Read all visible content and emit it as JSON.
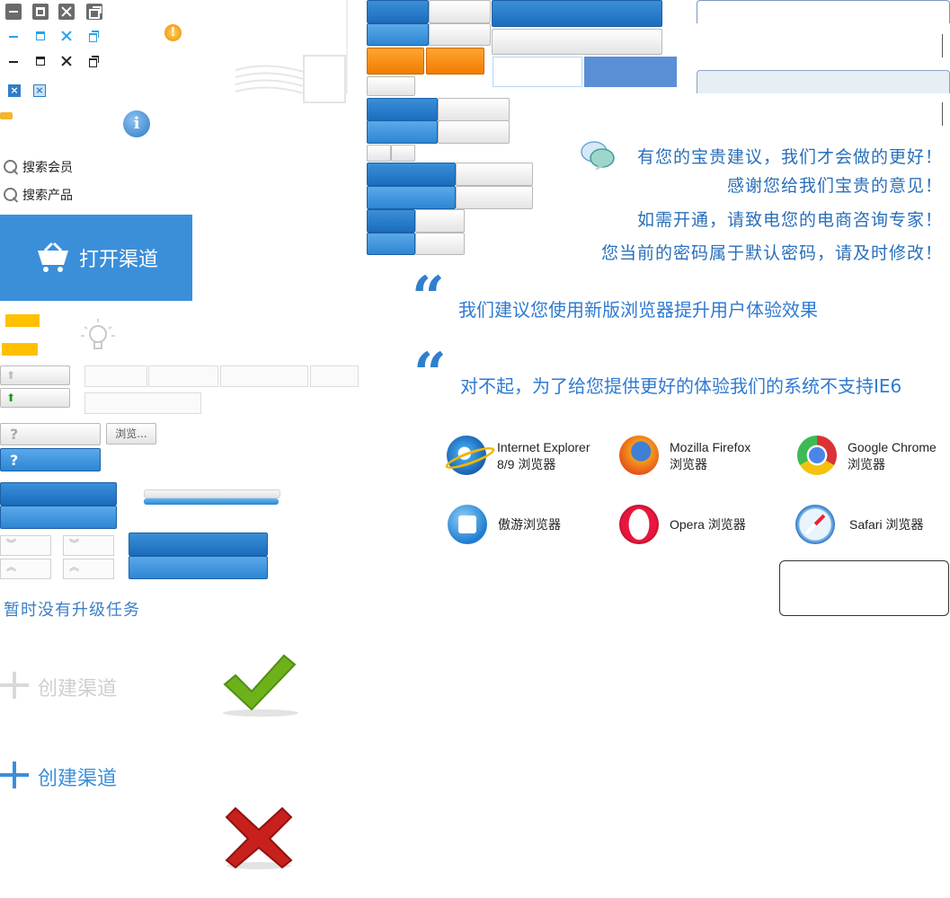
{
  "search": {
    "members": "搜索会员",
    "products": "搜索产品"
  },
  "open_channel": {
    "label": "打开渠道"
  },
  "browse_button": "浏览...",
  "no_upgrade": "暂时没有升级任务",
  "create_channel_disabled": "创建渠道",
  "create_channel": "创建渠道",
  "feedback_messages": [
    "有您的宝贵建议，我们才会做的更好！",
    "感谢您给我们宝贵的意见！",
    "如需开通，请致电您的电商咨询专家！",
    "您当前的密码属于默认密码，请及时修改！"
  ],
  "browser_notice": {
    "recommend": "我们建议您使用新版浏览器提升用户体验效果",
    "not_supported": "对不起，为了给您提供更好的体验我们的系统不支持IE6"
  },
  "browsers": [
    {
      "name": "Internet Explorer",
      "sub": "8/9 浏览器",
      "icon": "ie-icon"
    },
    {
      "name": "Mozilla Firefox",
      "sub": "浏览器",
      "icon": "firefox-icon"
    },
    {
      "name": "Google Chrome",
      "sub": "浏览器",
      "icon": "chrome-icon"
    },
    {
      "name": "傲游浏览器",
      "sub": "",
      "icon": "maxthon-icon"
    },
    {
      "name": "Opera 浏览器",
      "sub": "",
      "icon": "opera-icon"
    },
    {
      "name": "Safari 浏览器",
      "sub": "",
      "icon": "safari-icon"
    }
  ],
  "colors": {
    "accent_blue": "#3b8fd9",
    "text_blue": "#2f7ad2",
    "orange": "#f08a00",
    "success_green": "#6db21a",
    "error_red": "#c8201c"
  }
}
